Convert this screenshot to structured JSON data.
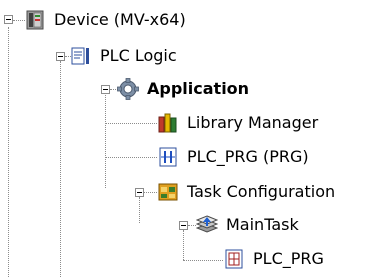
{
  "tree": {
    "device": {
      "label": "Device (MV-x64)"
    },
    "plc_logic": {
      "label": "PLC Logic"
    },
    "application": {
      "label": "Application"
    },
    "library": {
      "label": "Library Manager"
    },
    "plc_prg": {
      "label": "PLC_PRG (PRG)"
    },
    "task_config": {
      "label": "Task Configuration"
    },
    "main_task": {
      "label": "MainTask"
    },
    "task_plc_prg": {
      "label": "PLC_PRG"
    }
  },
  "icons": {
    "device": "device-icon",
    "plc_logic": "plc-logic-icon",
    "application": "gear-icon",
    "library": "books-icon",
    "plc_prg": "pou-icon",
    "task_config": "task-configuration-icon",
    "main_task": "task-stack-icon",
    "task_plc_prg": "program-call-icon"
  }
}
